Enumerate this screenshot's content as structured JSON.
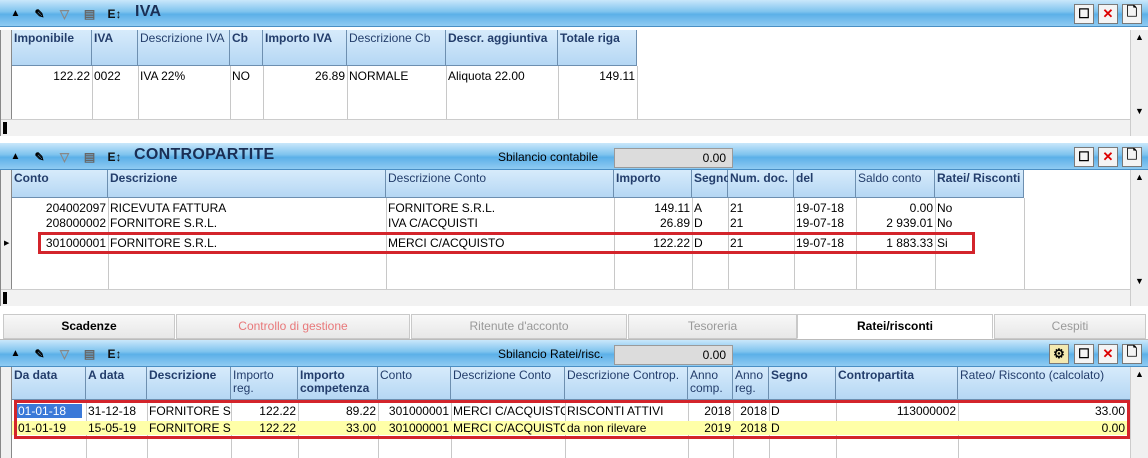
{
  "iva_panel": {
    "title": "IVA",
    "columns": [
      "Imponibile",
      "IVA",
      "Descrizione IVA",
      "Cb",
      "Importo IVA",
      "Descrizione Cb",
      "Descr. aggiuntiva",
      "Totale riga"
    ],
    "rows": [
      [
        "122.22",
        "0022",
        "IVA 22%",
        "NO",
        "26.89",
        "NORMALE",
        "Aliquota 22.00",
        "149.11"
      ]
    ]
  },
  "contropartite_panel": {
    "title": "CONTROPARTITE",
    "sbilancio_label": "Sbilancio contabile",
    "sbilancio_value": "0.00",
    "columns": [
      "Conto",
      "Descrizione",
      "Descrizione Conto",
      "Importo",
      "Segno",
      "Num. doc.",
      "del",
      "Saldo conto",
      "Ratei/ Risconti"
    ],
    "rows": [
      [
        "204002097",
        "RICEVUTA FATTURA",
        "FORNITORE S.R.L.",
        "149.11",
        "A",
        "21",
        "19-07-18",
        "0.00",
        "No"
      ],
      [
        "208000002",
        "FORNITORE S.R.L.",
        "IVA C/ACQUISTI",
        "26.89",
        "D",
        "21",
        "19-07-18",
        "2 939.01",
        "No"
      ],
      [
        "301000001",
        "FORNITORE S.R.L.",
        "MERCI C/ACQUISTO",
        "122.22",
        "D",
        "21",
        "19-07-18",
        "1 883.33",
        "Si"
      ]
    ]
  },
  "tabs": [
    "Scadenze",
    "Controllo di gestione",
    "Ritenute d'acconto",
    "Tesoreria",
    "Ratei/risconti",
    "Cespiti"
  ],
  "ratei_panel": {
    "sbilancio_label": "Sbilancio Ratei/risc.",
    "sbilancio_value": "0.00",
    "columns": [
      "Da data",
      "A data",
      "Descrizione",
      "Importo reg.",
      "Importo competenza",
      "Conto",
      "Descrizione Conto",
      "Descrizione Controp.",
      "Anno comp.",
      "Anno reg.",
      "Segno",
      "Contropartita",
      "Rateo/ Risconto (calcolato)"
    ],
    "rows": [
      [
        "01-01-18",
        "31-12-18",
        "FORNITORE S",
        "122.22",
        "89.22",
        "301000001",
        "MERCI C/ACQUISTO",
        "RISCONTI ATTIVI",
        "2018",
        "2018",
        "D",
        "113000002",
        "33.00"
      ],
      [
        "01-01-19",
        "15-05-19",
        "FORNITORE S",
        "122.22",
        "33.00",
        "301000001",
        "MERCI C/ACQUISTO",
        "da non rilevare",
        "2019",
        "2018",
        "D",
        "",
        "0.00"
      ]
    ]
  },
  "colors": {
    "titlebar": "#7ec3ee",
    "header_text": "#233d6b",
    "highlight_red": "#d3242b",
    "row_yellow": "#ffffa8",
    "inactive_tab": "#e8787a"
  }
}
